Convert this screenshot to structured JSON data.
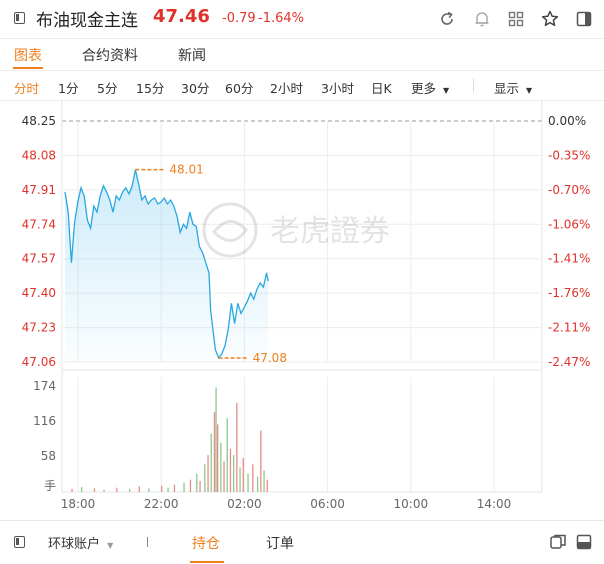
{
  "header": {
    "title": "布油现金主连",
    "price": "47.46",
    "change": "-0.79",
    "change_pct": "-1.64%",
    "icons": [
      "refresh-icon",
      "bell-icon",
      "grid-icon",
      "star-icon",
      "panel-icon"
    ]
  },
  "tabs": [
    "图表",
    "合约资料",
    "新闻"
  ],
  "periods": [
    "分时",
    "1分",
    "5分",
    "15分",
    "30分",
    "60分",
    "2小时",
    "3小时",
    "日K",
    "更多"
  ],
  "display_label": "显示",
  "watermark": "老虎證券",
  "chart_data": {
    "type": "line",
    "y_left_ticks": [
      "48.25",
      "48.08",
      "47.91",
      "47.74",
      "47.57",
      "47.40",
      "47.23",
      "47.06"
    ],
    "y_right_ticks": [
      "0.00%",
      "-0.35%",
      "-0.70%",
      "-1.06%",
      "-1.41%",
      "-1.76%",
      "-2.11%",
      "-2.47%"
    ],
    "ylim": [
      47.06,
      48.25
    ],
    "x_ticks": [
      "18:00",
      "22:00",
      "02:00",
      "06:00",
      "10:00",
      "14:00"
    ],
    "high_label": "48.01",
    "low_label": "47.08",
    "prev_close": 48.25,
    "price_series": [
      [
        0,
        47.9
      ],
      [
        0.1,
        47.8
      ],
      [
        0.2,
        47.55
      ],
      [
        0.3,
        47.75
      ],
      [
        0.4,
        47.85
      ],
      [
        0.5,
        47.92
      ],
      [
        0.6,
        47.88
      ],
      [
        0.7,
        47.76
      ],
      [
        0.8,
        47.72
      ],
      [
        0.9,
        47.83
      ],
      [
        1.0,
        47.8
      ],
      [
        1.1,
        47.88
      ],
      [
        1.2,
        47.93
      ],
      [
        1.3,
        47.9
      ],
      [
        1.4,
        47.86
      ],
      [
        1.5,
        47.8
      ],
      [
        1.6,
        47.88
      ],
      [
        1.7,
        47.86
      ],
      [
        1.8,
        47.9
      ],
      [
        1.9,
        47.92
      ],
      [
        2.0,
        47.89
      ],
      [
        2.1,
        47.93
      ],
      [
        2.2,
        48.01
      ],
      [
        2.3,
        47.94
      ],
      [
        2.4,
        47.86
      ],
      [
        2.5,
        47.88
      ],
      [
        2.6,
        47.84
      ],
      [
        2.7,
        47.86
      ],
      [
        2.8,
        47.87
      ],
      [
        2.9,
        47.84
      ],
      [
        3.0,
        47.85
      ],
      [
        3.1,
        47.87
      ],
      [
        3.2,
        47.84
      ],
      [
        3.3,
        47.86
      ],
      [
        3.4,
        47.83
      ],
      [
        3.5,
        47.78
      ],
      [
        3.6,
        47.7
      ],
      [
        3.7,
        47.74
      ],
      [
        3.8,
        47.72
      ],
      [
        3.9,
        47.8
      ],
      [
        4.0,
        47.74
      ],
      [
        4.1,
        47.73
      ],
      [
        4.2,
        47.63
      ],
      [
        4.3,
        47.6
      ],
      [
        4.4,
        47.55
      ],
      [
        4.5,
        47.5
      ],
      [
        4.55,
        47.32
      ],
      [
        4.6,
        47.25
      ],
      [
        4.7,
        47.12
      ],
      [
        4.8,
        47.08
      ],
      [
        4.9,
        47.1
      ],
      [
        5.0,
        47.14
      ],
      [
        5.1,
        47.22
      ],
      [
        5.2,
        47.35
      ],
      [
        5.3,
        47.25
      ],
      [
        5.4,
        47.35
      ],
      [
        5.5,
        47.3
      ],
      [
        5.6,
        47.33
      ],
      [
        5.7,
        47.36
      ],
      [
        5.8,
        47.4
      ],
      [
        5.9,
        47.37
      ],
      [
        6.0,
        47.42
      ],
      [
        6.1,
        47.45
      ],
      [
        6.2,
        47.43
      ],
      [
        6.3,
        47.5
      ],
      [
        6.35,
        47.46
      ]
    ],
    "volume_ticks": [
      "174",
      "116",
      "58",
      "手"
    ],
    "volume_max": 174,
    "volume_series": [
      [
        0.2,
        5,
        "up"
      ],
      [
        0.5,
        8,
        "down"
      ],
      [
        0.9,
        6,
        "up"
      ],
      [
        1.2,
        4,
        "down"
      ],
      [
        1.6,
        7,
        "up"
      ],
      [
        2.0,
        5,
        "down"
      ],
      [
        2.3,
        9,
        "up"
      ],
      [
        2.6,
        6,
        "down"
      ],
      [
        3.0,
        10,
        "up"
      ],
      [
        3.2,
        7,
        "down"
      ],
      [
        3.4,
        12,
        "up"
      ],
      [
        3.7,
        15,
        "down"
      ],
      [
        3.9,
        20,
        "up"
      ],
      [
        4.1,
        30,
        "down"
      ],
      [
        4.2,
        18,
        "up"
      ],
      [
        4.35,
        45,
        "down"
      ],
      [
        4.45,
        60,
        "up"
      ],
      [
        4.55,
        95,
        "down"
      ],
      [
        4.65,
        130,
        "up"
      ],
      [
        4.7,
        170,
        "down"
      ],
      [
        4.75,
        110,
        "up"
      ],
      [
        4.85,
        80,
        "down"
      ],
      [
        4.95,
        50,
        "up"
      ],
      [
        5.05,
        120,
        "down"
      ],
      [
        5.15,
        70,
        "up"
      ],
      [
        5.25,
        60,
        "down"
      ],
      [
        5.35,
        145,
        "up"
      ],
      [
        5.45,
        40,
        "down"
      ],
      [
        5.55,
        55,
        "up"
      ],
      [
        5.7,
        30,
        "down"
      ],
      [
        5.85,
        45,
        "up"
      ],
      [
        6.0,
        25,
        "down"
      ],
      [
        6.1,
        100,
        "up"
      ],
      [
        6.2,
        35,
        "down"
      ],
      [
        6.3,
        20,
        "up"
      ]
    ]
  },
  "footer": {
    "account_label": "环球账户",
    "tabs": [
      "持仓",
      "订单"
    ]
  }
}
